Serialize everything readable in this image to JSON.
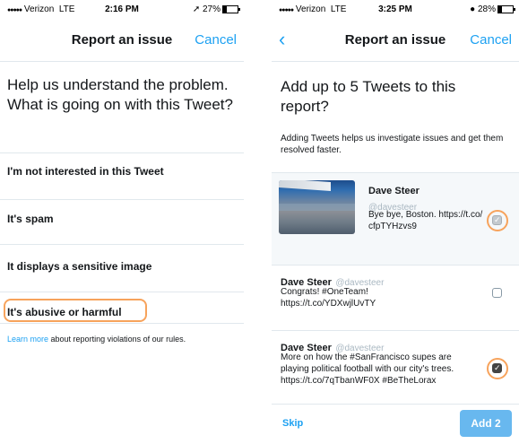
{
  "left_screen": {
    "status": {
      "carrier": "Verizon",
      "network": "LTE",
      "time": "2:16 PM",
      "battery_text": "27%",
      "battery_level": 0.27
    },
    "title": "Report an issue",
    "cancel": "Cancel",
    "prompt": "Help us understand the problem. What is going on with this Tweet?",
    "options": [
      "I'm not interested in this Tweet",
      "It's spam",
      "It displays a sensitive image",
      "It's abusive or harmful"
    ],
    "highlighted_option": "It's abusive or harmful",
    "learn_link": "Learn more",
    "learn_text": " about reporting violations of our rules."
  },
  "right_screen": {
    "status": {
      "carrier": "Verizon",
      "network": "LTE",
      "time": "3:25 PM",
      "battery_text": "28%",
      "battery_level": 0.28
    },
    "title": "Report an issue",
    "cancel": "Cancel",
    "back_icon": "chevron-left-icon",
    "prompt": "Add up to 5 Tweets to this report?",
    "subtext": "Adding Tweets helps us investigate issues and get them resolved faster.",
    "tweets": [
      {
        "name": "Dave Steer",
        "handle": "@davesteer",
        "text": "Bye bye, Boston. https://t.co/cfpTYHzvs9",
        "checked": true,
        "disabled": true,
        "has_photo": true
      },
      {
        "name": "Dave Steer",
        "handle": "@davesteer",
        "text": "Congrats! #OneTeam! https://t.co/YDXwjlUvTY",
        "checked": false,
        "disabled": false
      },
      {
        "name": "Dave Steer",
        "handle": "@davesteer",
        "text": "More on how the #SanFrancisco supes are playing political football with our city's trees. https://t.co/7qTbanWF0X #BeTheLorax",
        "checked": true,
        "disabled": false
      }
    ],
    "skip": "Skip",
    "add_button": "Add 2"
  },
  "colors": {
    "accent": "#1da1f2",
    "highlight": "#f7a35c",
    "divider": "#e1e8ed",
    "muted": "#aab8c2"
  }
}
